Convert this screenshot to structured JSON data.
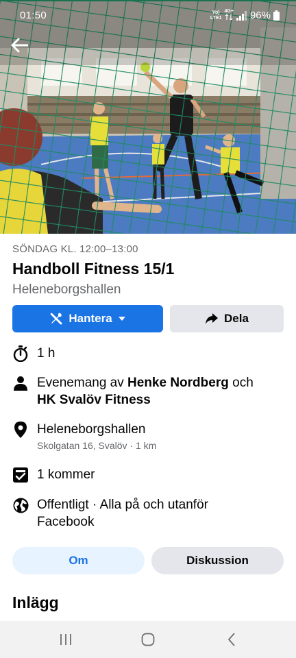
{
  "status": {
    "time": "01:50",
    "volte_top": "Vo)",
    "volte_bottom": "LTE1",
    "network": "4G+",
    "battery": "96%"
  },
  "event": {
    "date_line": "SÖNDAG KL. 12:00–13:00",
    "title": "Handboll Fitness 15/1",
    "venue": "Heleneborgshallen"
  },
  "actions": {
    "manage_label": "Hantera",
    "share_label": "Dela"
  },
  "details": {
    "duration": "1 h",
    "organizer_prefix": "Evenemang av ",
    "organizer_1": "Henke Nordberg",
    "organizer_joiner": " och",
    "organizer_2": "HK Svalöv Fitness",
    "location_name": "Heleneborgshallen",
    "location_address": "Skolgatan 16, Svalöv · 1 km",
    "attendance": "1 kommer",
    "privacy_line_1": "Offentligt · Alla på och utanför",
    "privacy_line_2": "Facebook"
  },
  "tabs": {
    "about": "Om",
    "discussion": "Diskussion"
  },
  "posts_title": "Inlägg",
  "icons": {
    "back": "arrow-left-icon",
    "manage": "tools-icon",
    "share": "share-arrow-icon",
    "duration": "stopwatch-icon",
    "organizer": "person-icon",
    "location": "map-pin-icon",
    "attendance": "checkbox-icon",
    "privacy": "globe-icon"
  },
  "colors": {
    "accent": "#1b74e4",
    "tab_active_bg": "#e7f3ff",
    "button_gray": "#e4e6eb",
    "secondary_text": "#65676b"
  }
}
